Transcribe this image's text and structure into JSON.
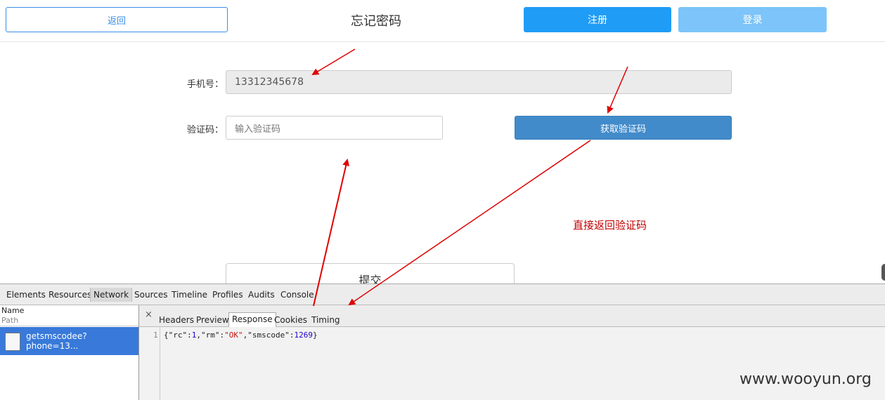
{
  "header": {
    "back_label": "返回",
    "title": "忘记密码",
    "register_label": "注册",
    "login_label": "登录"
  },
  "form": {
    "phone_label": "手机号：",
    "phone_value": "13312345678",
    "code_label": "验证码：",
    "code_placeholder": "输入验证码",
    "get_code_label": "获取验证码",
    "submit_label": "提交"
  },
  "annotation": "直接返回验证码",
  "devtools": {
    "tabs": [
      "Elements",
      "Resources",
      "Network",
      "Sources",
      "Timeline",
      "Profiles",
      "Audits",
      "Console"
    ],
    "active_tab": "Network",
    "list_header_name": "Name",
    "list_header_path": "Path",
    "request_name": "getsmscodee?phone=13...",
    "close_icon": "×",
    "detail_tabs": [
      "Headers",
      "Preview",
      "Response",
      "Cookies",
      "Timing"
    ],
    "active_detail_tab": "Response",
    "line_number": "1",
    "response": {
      "open": "{",
      "k1": "\"rc\"",
      "v1": "1",
      "k2": "\"rm\"",
      "v2": "\"OK\"",
      "k3": "\"smscode\"",
      "v3": "1269",
      "close": "}"
    }
  },
  "watermark": "www.wooyun.org",
  "colors": {
    "primary": "#1f9cf6",
    "primary_light": "#7cc4f9",
    "get_code": "#428bca",
    "selected_row": "#3879d9",
    "annotation_red": "#c00000",
    "arrow_red": "#e00000"
  }
}
